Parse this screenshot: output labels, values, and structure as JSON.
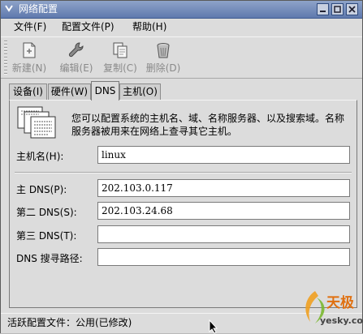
{
  "window": {
    "title": "网络配置"
  },
  "menubar": {
    "items": [
      {
        "label": "文件(F)"
      },
      {
        "label": "配置文件(P)"
      },
      {
        "label": "帮助(H)"
      }
    ]
  },
  "toolbar": {
    "new_label": "新建(N)",
    "edit_label": "编辑(E)",
    "copy_label": "复制(C)",
    "delete_label": "删除(D)"
  },
  "tabs": [
    {
      "label": "设备(I)"
    },
    {
      "label": "硬件(W)"
    },
    {
      "label": "DNS"
    },
    {
      "label": "主机(O)"
    }
  ],
  "dns_panel": {
    "description": "您可以配置系统的主机名、域、名称服务器、以及搜索域。名称服务器被用来在网络上查寻其它主机。",
    "hostname_label": "主机名(H):",
    "hostname_value": "linux",
    "primary_dns_label": "主 DNS(P):",
    "primary_dns_value": "202.103.0.117",
    "secondary_dns_label": "第二 DNS(S):",
    "secondary_dns_value": "202.103.24.68",
    "tertiary_dns_label": "第三 DNS(T):",
    "tertiary_dns_value": "",
    "search_path_label": "DNS 搜寻路径:",
    "search_path_value": ""
  },
  "statusbar": {
    "text": "活跃配置文件：公用(已修改)"
  },
  "watermark": {
    "brand": "天极",
    "domain": "yesky.com"
  },
  "colors": {
    "titlebar": "#6f87b8",
    "window_bg": "#dcdcdc",
    "disabled_text": "#8a8a8a"
  }
}
